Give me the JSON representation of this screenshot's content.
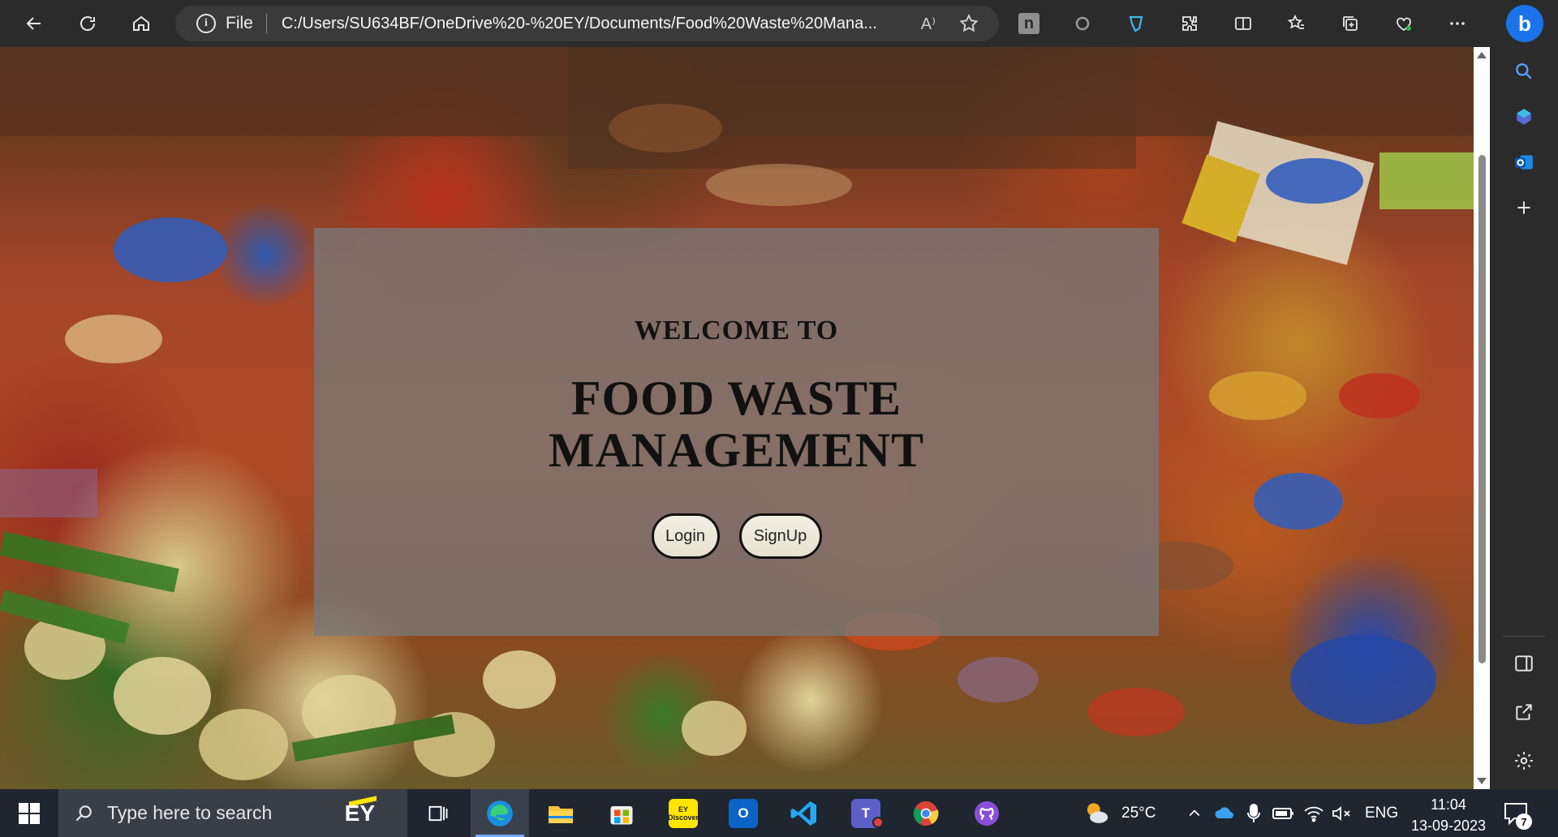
{
  "browser": {
    "address_protocol": "File",
    "url": "C:/Users/SU634BF/OneDrive%20-%20EY/Documents/Food%20Waste%20Mana...",
    "read_aloud_glyph": "A⁾",
    "extension_n_label": "n"
  },
  "page": {
    "welcome_text": "WELCOME TO",
    "title_line1": "FOOD WASTE",
    "title_line2": "MANAGEMENT",
    "login_label": "Login",
    "signup_label": "SignUp",
    "overlay_color": "#787878",
    "button_color": "#efece0"
  },
  "taskbar": {
    "search_placeholder": "Type here to search",
    "search_brand": "EY",
    "weather_temp": "25°C",
    "language": "ENG",
    "time": "11:04",
    "date": "13-09-2023",
    "notification_count": "7",
    "ey_discover_label_1": "EY",
    "ey_discover_label_2": "Discover",
    "teams_label": "T",
    "outlook_label": "O"
  },
  "icons": {
    "toolbar": [
      "back-icon",
      "refresh-icon",
      "home-icon",
      "info-icon",
      "read-aloud-icon",
      "favorite-star-icon",
      "extension-n-icon",
      "circle-extension-icon",
      "shield-extension-icon",
      "extensions-puzzle-icon",
      "split-screen-icon",
      "favorites-icon",
      "collections-icon",
      "browser-essentials-icon",
      "more-icon",
      "bing-chat-icon"
    ],
    "sidebar": [
      "search-icon",
      "copilot-icon",
      "outlook-icon",
      "add-icon",
      "sidebar-toggle-icon",
      "open-external-icon",
      "settings-gear-icon"
    ]
  }
}
